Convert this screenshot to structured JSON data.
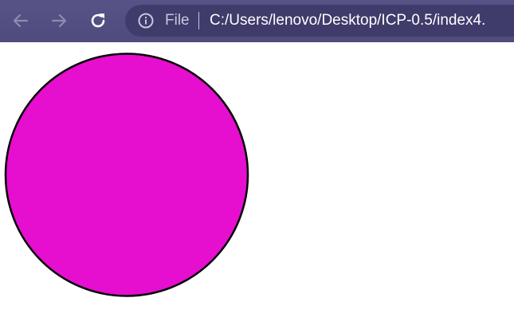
{
  "browser": {
    "back_icon": "arrow-left-icon",
    "forward_icon": "arrow-right-icon",
    "reload_icon": "reload-icon",
    "info_icon": "info-icon",
    "scheme_label": "File",
    "url": "C:/Users/lenovo/Desktop/ICP-0.5/index4.",
    "colors": {
      "toolbar": "#544f84",
      "omnibox": "#3f3b6b",
      "disabled_icon": "#8e8bb0",
      "url_text": "#ffffff"
    }
  },
  "page": {
    "circle": {
      "fill": "#e60ecf",
      "stroke": "#000000"
    }
  }
}
